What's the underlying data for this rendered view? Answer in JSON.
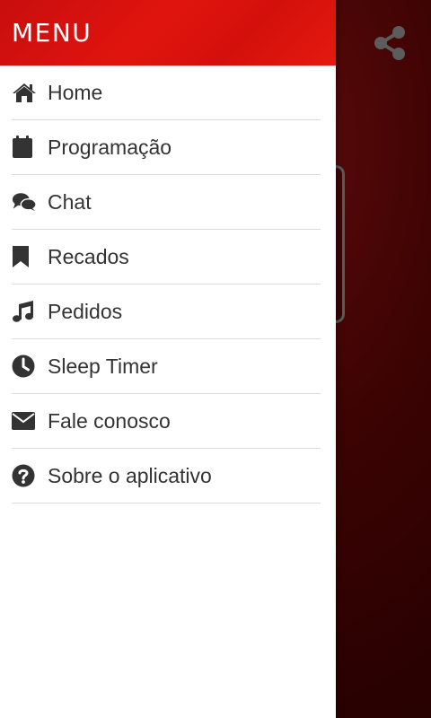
{
  "drawer": {
    "title": "MENU",
    "header_color": "#e0140e",
    "items": [
      {
        "label": "Home",
        "icon": "home-icon"
      },
      {
        "label": "Programação",
        "icon": "calendar-icon"
      },
      {
        "label": "Chat",
        "icon": "chat-icon"
      },
      {
        "label": "Recados",
        "icon": "bookmark-icon"
      },
      {
        "label": "Pedidos",
        "icon": "music-icon"
      },
      {
        "label": "Sleep Timer",
        "icon": "clock-icon"
      },
      {
        "label": "Fale conosco",
        "icon": "envelope-icon"
      },
      {
        "label": "Sobre o aplicativo",
        "icon": "question-circle-icon"
      }
    ]
  },
  "background": {
    "share_icon": "share-icon",
    "bg_color": "#3d0303"
  }
}
